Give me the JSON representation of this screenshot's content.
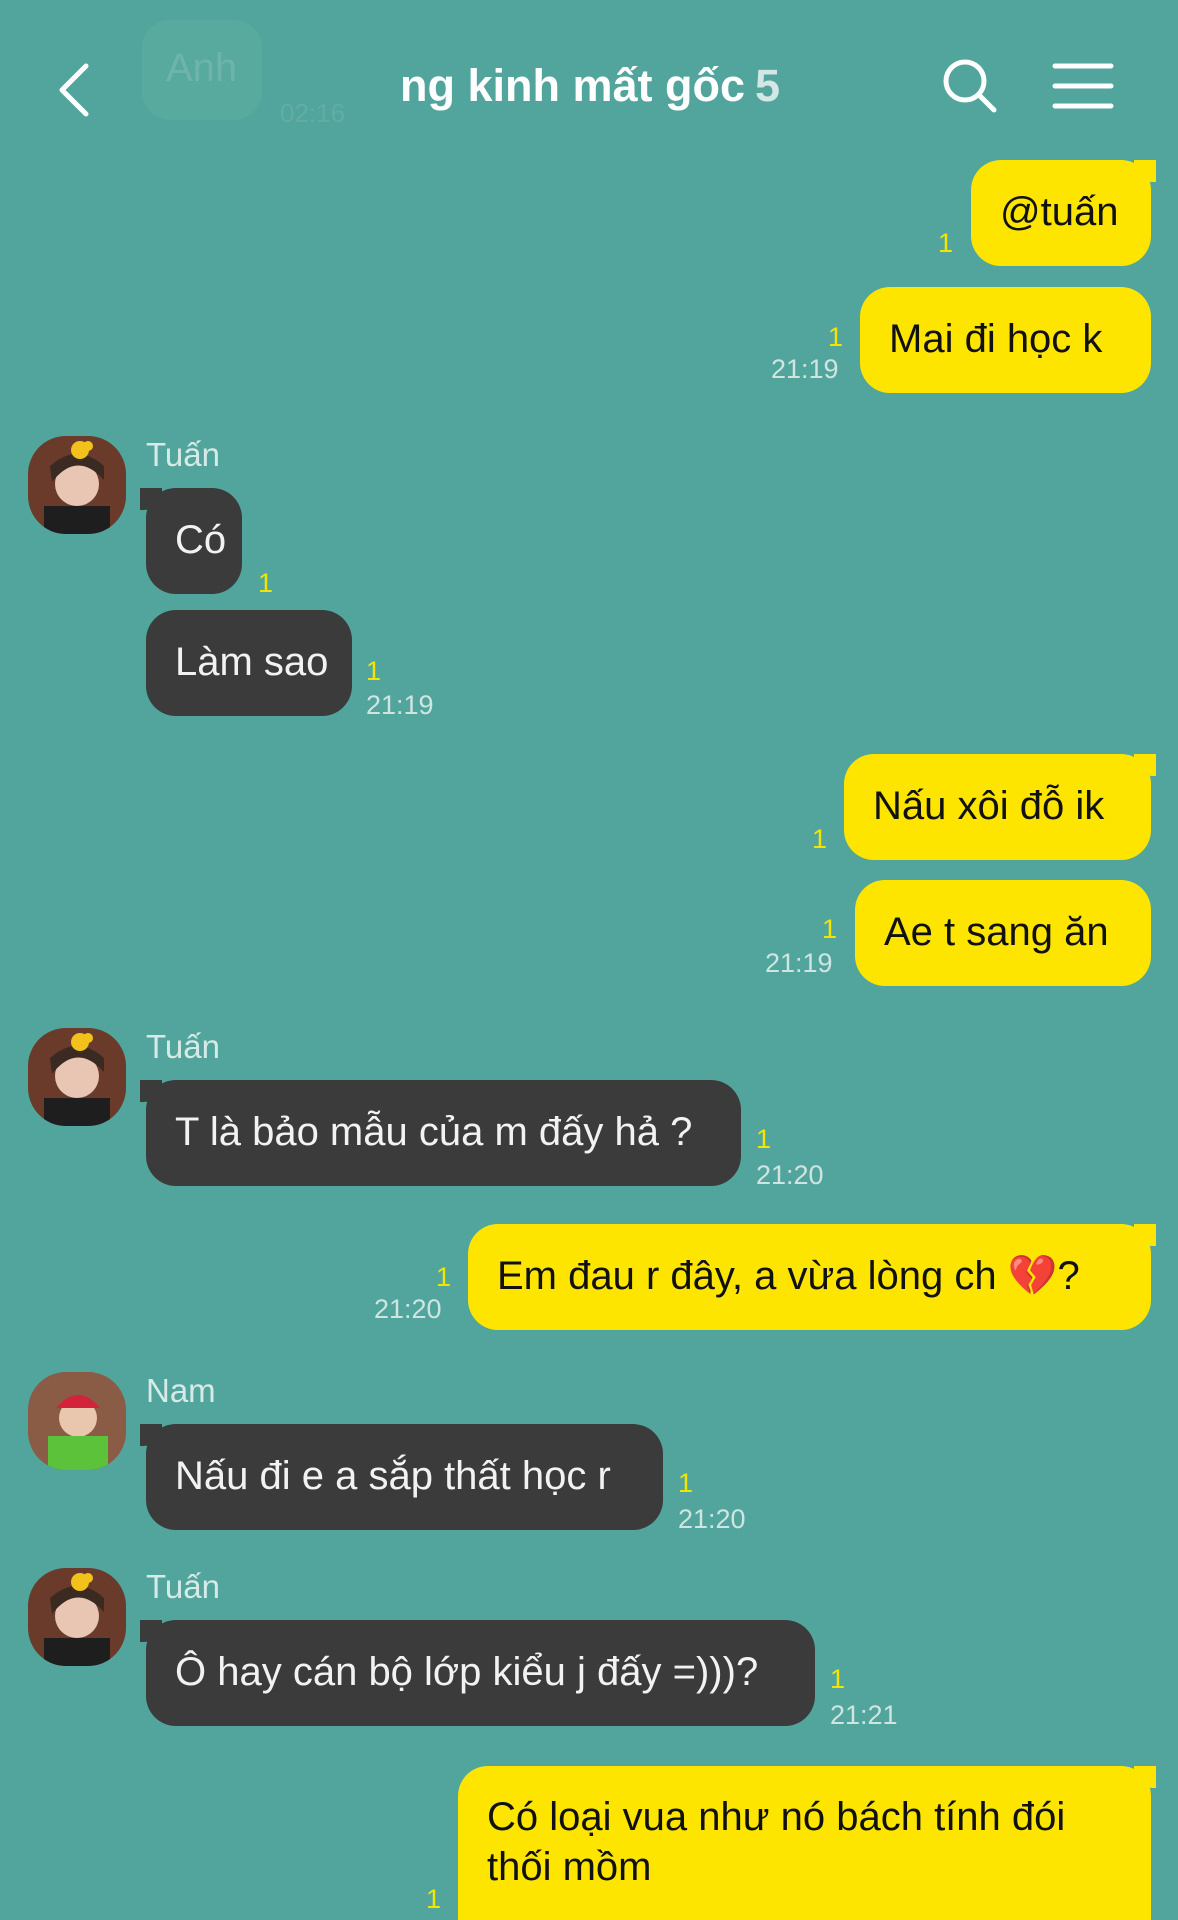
{
  "header": {
    "ghost_text": "Anh",
    "ghost_time": "02:16",
    "title": "ng kinh mất gốc",
    "member_count": "5"
  },
  "messages": [
    {
      "side": "me",
      "text": "@tuấn",
      "read": "1",
      "time": ""
    },
    {
      "side": "me",
      "text": "Mai đi học k",
      "read": "1",
      "time": "21:19"
    },
    {
      "side": "them",
      "sender": "Tuấn",
      "avatar": "tuan-avatar",
      "text": "Có",
      "read": "1",
      "time": ""
    },
    {
      "side": "them",
      "text": "Làm sao",
      "read": "1",
      "time": "21:19"
    },
    {
      "side": "me",
      "text": "Nấu xôi đỗ ik",
      "read": "1",
      "time": ""
    },
    {
      "side": "me",
      "text": "Ae t sang ăn",
      "read": "1",
      "time": "21:19"
    },
    {
      "side": "them",
      "sender": "Tuấn",
      "avatar": "tuan-avatar",
      "text": "T là bảo mẫu của m đấy hả ?",
      "read": "1",
      "time": "21:20"
    },
    {
      "side": "me",
      "text": "Em đau r đây, a vừa lòng ch 💔?",
      "read": "1",
      "time": "21:20"
    },
    {
      "side": "them",
      "sender": "Nam",
      "avatar": "nam-avatar",
      "text": "Nấu đi e a sắp thất học r",
      "read": "1",
      "time": "21:20"
    },
    {
      "side": "them",
      "sender": "Tuấn",
      "avatar": "tuan-avatar",
      "text": "Ô hay cán bộ lớp kiểu j đấy =)))?",
      "read": "1",
      "time": "21:21"
    },
    {
      "side": "me",
      "text": "Có loại vua như nó bách tính đói thối mồm",
      "text_line1": "Có loại vua như nó bách tính đói",
      "text_line2": "thối mồm",
      "read": "1",
      "time": ""
    }
  ],
  "colors": {
    "background": "#52a59c",
    "my_bubble": "#fde500",
    "their_bubble": "#3b3b3b",
    "read_indicator": "#f5e400"
  }
}
